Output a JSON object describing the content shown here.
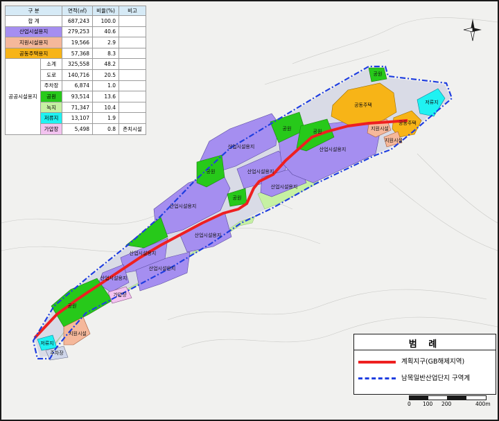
{
  "table": {
    "headers": [
      "구 분",
      "면적(㎡)",
      "비율(%)",
      "비고"
    ],
    "rows": [
      {
        "key": "total",
        "label": "합 계",
        "area": "687,243",
        "ratio": "100.0",
        "note": ""
      },
      {
        "key": "ind",
        "label": "산업시설용지",
        "area": "279,253",
        "ratio": "40.6",
        "note": ""
      },
      {
        "key": "sup",
        "label": "지원시설용지",
        "area": "19,566",
        "ratio": "2.9",
        "note": ""
      },
      {
        "key": "com",
        "label": "공동주택용지",
        "area": "57,368",
        "ratio": "8.3",
        "note": ""
      }
    ],
    "public_group_label": "공공시설용지",
    "public_rows": [
      {
        "key": "sub",
        "label": "소계",
        "area": "325,558",
        "ratio": "48.2",
        "note": ""
      },
      {
        "key": "road",
        "label": "도로",
        "area": "140,716",
        "ratio": "20.5",
        "note": ""
      },
      {
        "key": "parking",
        "label": "주차장",
        "area": "6,874",
        "ratio": "1.0",
        "note": ""
      },
      {
        "key": "park",
        "label": "공원",
        "area": "93,514",
        "ratio": "13.6",
        "note": ""
      },
      {
        "key": "green",
        "label": "녹지",
        "area": "71,347",
        "ratio": "10.4",
        "note": ""
      },
      {
        "key": "res",
        "label": "저류지",
        "area": "13,107",
        "ratio": "1.9",
        "note": ""
      },
      {
        "key": "lpg",
        "label": "가압장",
        "area": "5,498",
        "ratio": "0.8",
        "note": "존치시설"
      }
    ]
  },
  "map_labels": {
    "industrial": "산업시설용지",
    "park": "공원",
    "support": "지원시설",
    "apartment": "공동주택",
    "reservoir": "저류지",
    "parking": "주차장",
    "pressure_station": "가압장"
  },
  "legend": {
    "title": "범 례",
    "items": [
      {
        "label": "계획지구(GB해제지역)",
        "color": "#ee2020",
        "style": "solid"
      },
      {
        "label": "남목일반산업단지 구역계",
        "color": "#1f3ee0",
        "style": "dash-dot"
      }
    ]
  },
  "scale": {
    "labels": [
      "0",
      "100",
      "200",
      "400m"
    ]
  },
  "colors": {
    "industrial": "#a58ef0",
    "park": "#27c91a",
    "support": "#f5b89b",
    "apartment": "#f7b417",
    "green": "#c6f0a3",
    "reservoir": "#1ff2f2",
    "pressure": "#f3c3f0",
    "road": "#d9dbe6",
    "gb_line": "#ee2020",
    "boundary": "#1f3ee0"
  },
  "compass": {
    "icon": "north-arrow-icon"
  }
}
